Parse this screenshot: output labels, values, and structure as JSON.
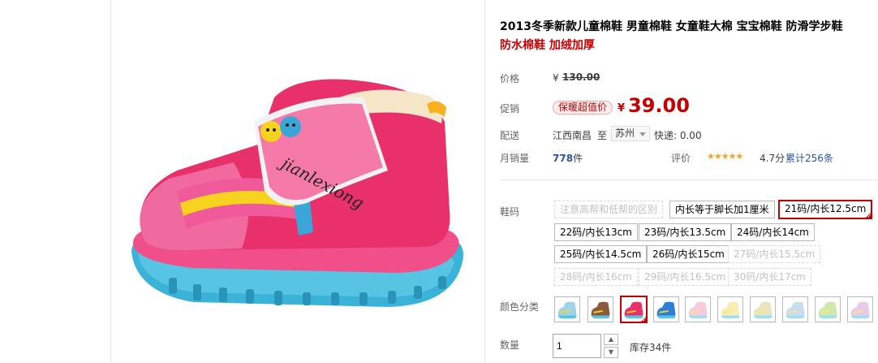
{
  "product": {
    "title": "2013冬季新款儿童棉鞋 男童棉鞋 女童鞋大棉 宝宝棉鞋 防滑学步鞋",
    "promo_text": "防水棉鞋 加绒加厚",
    "image_brand_text": "jianlexiong"
  },
  "price": {
    "label": "价格",
    "currency": "¥",
    "original": "130.00"
  },
  "promotion": {
    "label": "促销",
    "badge": "保暖超值价",
    "currency": "¥",
    "price": "39.00"
  },
  "shipping": {
    "label": "配送",
    "from": "江西南昌",
    "to_label": "至",
    "to_city": "苏州",
    "fee_text": "快递: 0.00"
  },
  "sales": {
    "label": "月销量",
    "count": "778",
    "unit": "件",
    "rating_label": "评价",
    "stars": "★★★★★",
    "rating": "4.7分",
    "reviews": "累计256条"
  },
  "size": {
    "label": "鞋码",
    "options": [
      "注意高帮和低帮的区别",
      "内长等于脚长加1厘米",
      "21码/内长12.5cm",
      "22码/内长13cm",
      "23码/内长13.5cm",
      "24码/内长14cm",
      "25码/内长14.5cm",
      "26码/内长15cm",
      "27码/内长15.5cm",
      "28码/内长16cm",
      "29码/内长16.5cm",
      "30码/内长17cm"
    ],
    "selected": "21码/内长12.5cm"
  },
  "color": {
    "label": "颜色分类",
    "swatches": [
      "#9fd3e6",
      "#8b5a3c",
      "#e8306a",
      "#2f7fd6",
      "#f2a0c8",
      "#f4e07a",
      "#d8d090",
      "#9fc0e8",
      "#a8d66a",
      "#d8a0d8"
    ],
    "selected_index": 2
  },
  "quantity": {
    "label": "数量",
    "value": "1",
    "stock": "库存34件"
  },
  "colors": {
    "accent": "#c40000",
    "link": "#2953a6",
    "shoe_main": "#e8306a",
    "shoe_sole": "#3bb3d9"
  }
}
